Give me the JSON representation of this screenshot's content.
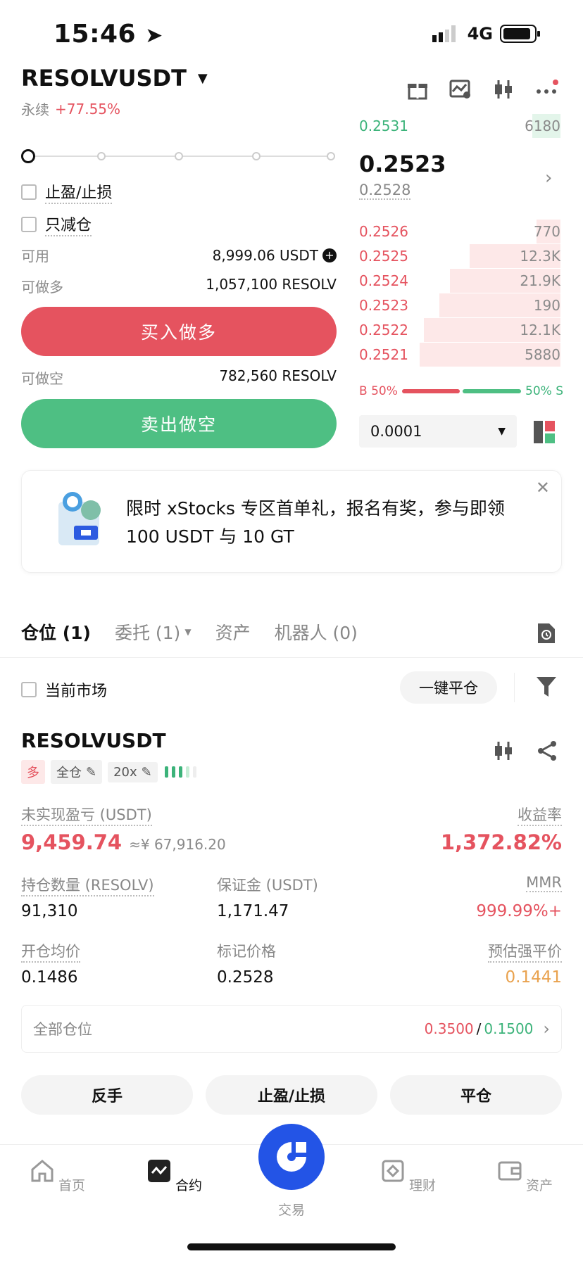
{
  "status_bar": {
    "time": "15:46",
    "network": "4G"
  },
  "header": {
    "pair": "RESOLVUSDT",
    "type": "永续",
    "change": "+77.55%"
  },
  "order_form": {
    "tp_sl": "止盈/止损",
    "reduce_only": "只减仓",
    "available_label": "可用",
    "available_value": "8,999.06 USDT",
    "can_long_label": "可做多",
    "can_long_value": "1,057,100 RESOLV",
    "buy_button": "买入做多",
    "can_short_label": "可做空",
    "can_short_value": "782,560 RESOLV",
    "sell_button": "卖出做空"
  },
  "order_book": {
    "top_price": "0.2531",
    "top_size": "6180",
    "last_price": "0.2523",
    "mark_price": "0.2528",
    "bids": [
      {
        "price": "0.2526",
        "size": "770",
        "depth": 0.12
      },
      {
        "price": "0.2525",
        "size": "12.3K",
        "depth": 0.45
      },
      {
        "price": "0.2524",
        "size": "21.9K",
        "depth": 0.55
      },
      {
        "price": "0.2523",
        "size": "190",
        "depth": 0.6
      },
      {
        "price": "0.2522",
        "size": "12.1K",
        "depth": 0.68
      },
      {
        "price": "0.2521",
        "size": "5880",
        "depth": 0.7
      }
    ],
    "buy_ratio": "B 50%",
    "sell_ratio": "50% S",
    "buy_fraction": 0.5,
    "precision": "0.0001"
  },
  "banner": {
    "line1": "限时 xStocks 专区首单礼，报名有奖，参与即领",
    "line2": "100 USDT 与 10 GT"
  },
  "tabs": {
    "positions": "仓位 (1)",
    "orders": "委托 (1)",
    "assets": "资产",
    "bots": "机器人 (0)"
  },
  "filter": {
    "current_market": "当前市场",
    "close_all": "一键平仓"
  },
  "position": {
    "pair": "RESOLVUSDT",
    "side": "多",
    "margin_mode": "全仓",
    "leverage": "20x",
    "unrealized_label": "未实现盈亏 (USDT)",
    "unrealized_value": "9,459.74",
    "unrealized_cny": "≈¥ 67,916.20",
    "roe_label": "收益率",
    "roe_value": "1,372.82%",
    "size_label": "持仓数量 (RESOLV)",
    "size_value": "91,310",
    "margin_label": "保证金 (USDT)",
    "margin_value": "1,171.47",
    "mmr_label": "MMR",
    "mmr_value": "999.99%+",
    "entry_label": "开仓均价",
    "entry_value": "0.1486",
    "mark_label": "标记价格",
    "mark_value": "0.2528",
    "liq_label": "预估强平价",
    "liq_value": "0.1441",
    "all_positions_label": "全部仓位",
    "tp_value": "0.3500",
    "sl_value": "0.1500",
    "reverse_button": "反手",
    "tpsl_button": "止盈/止损",
    "close_button": "平仓"
  },
  "nav": {
    "home": "首页",
    "futures": "合约",
    "trade": "交易",
    "finance": "理财",
    "assets": "资产"
  },
  "colors": {
    "red": "#e5535f",
    "green": "#3cb37a",
    "brand": "#2354e6",
    "orange": "#e9a24e"
  }
}
